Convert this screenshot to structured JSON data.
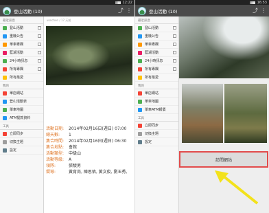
{
  "status": {
    "left_time": "12:22",
    "right_time": "16:53"
  },
  "app": {
    "title": "登山活動 (10)"
  },
  "drawer": {
    "sections": {
      "news": "最近訊息",
      "mine": "我的",
      "tools": "工具"
    },
    "left_items": [
      {
        "label": "登山活動",
        "color": "#4caf50"
      },
      {
        "label": "重機公告",
        "color": "#2196f3"
      },
      {
        "label": "單車專欄",
        "color": "#ff9800"
      },
      {
        "label": "藍湖活動",
        "color": "#e91e63"
      },
      {
        "label": "24小時訊息",
        "color": "#4caf50"
      },
      {
        "label": "所有專欄",
        "color": "#f44336"
      },
      {
        "label": "所有最愛",
        "color": "#ffc107"
      },
      {
        "label": "單店網站",
        "color": "#f44336"
      },
      {
        "label": "登山活動表",
        "color": "#2196f3"
      },
      {
        "label": "單車地圖",
        "color": "#4caf50"
      },
      {
        "label": "ATM提款資料",
        "color": "#2196f3"
      },
      {
        "label": "立即同步",
        "color": "#f44336"
      },
      {
        "label": "切換主題",
        "color": "#9e9e9e"
      },
      {
        "label": "設定",
        "color": "#607d8b"
      }
    ],
    "right_items": [
      {
        "label": "登山活動",
        "color": "#4caf50"
      },
      {
        "label": "重機公告",
        "color": "#2196f3"
      },
      {
        "label": "單車專欄",
        "color": "#ff9800"
      },
      {
        "label": "藍湖活動",
        "color": "#e91e63"
      },
      {
        "label": "24小時訊息",
        "color": "#4caf50"
      },
      {
        "label": "所有專欄",
        "color": "#f44336"
      },
      {
        "label": "所有最愛",
        "color": "#ffc107"
      },
      {
        "label": "單店網站",
        "color": "#f44336"
      },
      {
        "label": "單車地圖",
        "color": "#4caf50"
      },
      {
        "label": "單車ATM報價",
        "color": "#2196f3"
      },
      {
        "label": "立即同步",
        "color": "#f44336"
      },
      {
        "label": "切換主題",
        "color": "#9e9e9e"
      },
      {
        "label": "設定",
        "color": "#607d8b"
      }
    ]
  },
  "post": {
    "meta": "vonchen / 17 天前",
    "rows": [
      {
        "k": "活動日期:",
        "v": "2014年02月16日(週日) 07:00"
      },
      {
        "k": "總天數:",
        "v": "1"
      },
      {
        "k": "集合時間:",
        "v": "2014年02月16日(週日) 06:30"
      },
      {
        "k": "集合地點:",
        "v": "會館"
      },
      {
        "k": "活動類型:",
        "v": "中級山"
      },
      {
        "k": "活動等級:",
        "v": "A"
      },
      {
        "k": "領隊:",
        "v": "張駿男"
      },
      {
        "k": "嚮導:",
        "v": "黃育尚, 陳思佑, 黃文俊, 劉玉秀,"
      }
    ]
  },
  "right": {
    "visit_button": "訪問網站"
  },
  "colors": {
    "accent": "#e07a2d",
    "highlight": "#e24b4b",
    "arrow": "#f3e21b"
  }
}
